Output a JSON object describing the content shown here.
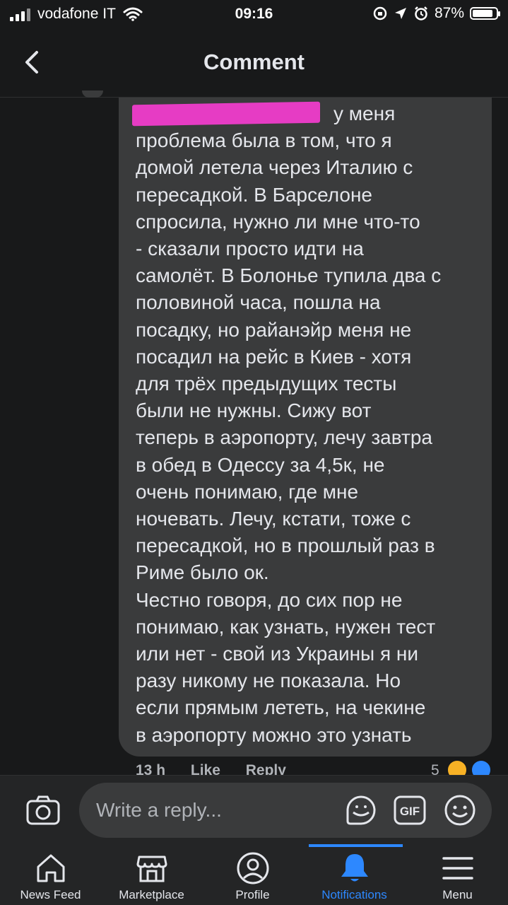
{
  "status_bar": {
    "carrier": "vodafone IT",
    "time": "09:16",
    "battery": "87%",
    "battery_level": 0.87
  },
  "header": {
    "title": "Comment"
  },
  "comment": {
    "text": "у меня\nпроблема была в том, что я\nдомой летела через Италию с\nпересадкой. В Барселоне\nспросила, нужно ли мне что-то\n- сказали просто идти на\nсамолёт. В Болонье тупила два с\nполовиной часа, пошла на\nпосадку, но райанэйр меня не\nпосадил на рейс в Киев - хотя\nдля трёх предыдущих тесты\nбыли не нужны. Сижу вот\nтеперь в аэропорту, лечу завтра\nв обед в Одессу за 4,5к, не\nочень понимаю, где мне\nночевать. Лечу, кстати, тоже с\nпересадкой, но в прошлый раз в\nРиме было ок.\nЧестно говоря, до сих пор не\nпонимаю, как узнать, нужен тест\nили нет - свой из Украины я ни\nразу никому не показала. Но\nесли прямым лететь, на чекине\nв аэропорту можно это узнать",
    "timestamp": "13 h",
    "like_label": "Like",
    "reply_label": "Reply",
    "reaction_count": "5"
  },
  "reply_bar": {
    "placeholder": "Write a reply..."
  },
  "tabs": [
    {
      "label": "News Feed"
    },
    {
      "label": "Marketplace"
    },
    {
      "label": "Profile"
    },
    {
      "label": "Notifications"
    },
    {
      "label": "Menu"
    }
  ],
  "colors": {
    "background": "#18191a",
    "bubble": "#3a3b3c",
    "accent": "#2d88ff",
    "redaction": "#e63cc4"
  }
}
